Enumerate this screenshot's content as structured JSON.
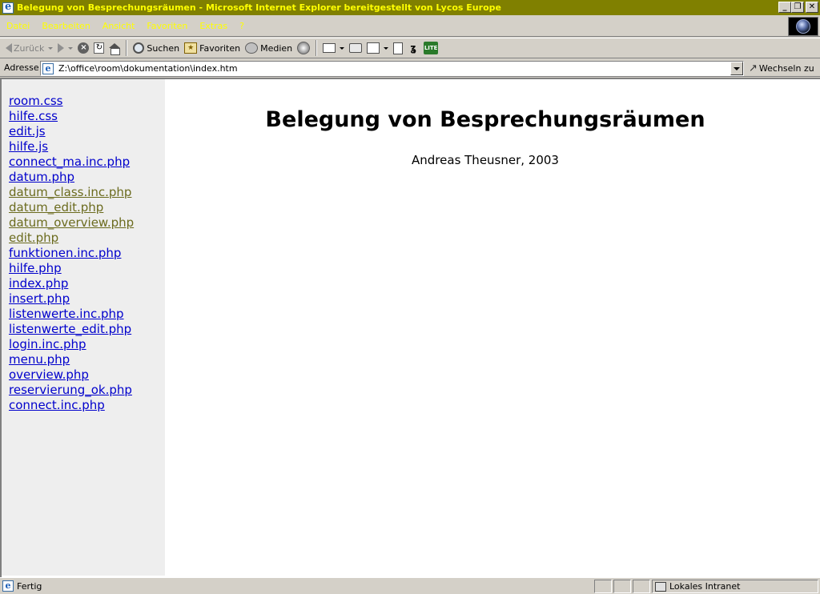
{
  "window": {
    "title": "Belegung von Besprechungsräumen - Microsoft Internet Explorer bereitgestellt von Lycos Europe",
    "minimize": "_",
    "maximize": "❐",
    "close": "✕"
  },
  "menu": {
    "items": [
      "Datei",
      "Bearbeiten",
      "Ansicht",
      "Favoriten",
      "Extras",
      "?"
    ]
  },
  "toolbar": {
    "back_label": "Zurück",
    "search_label": "Suchen",
    "favorites_label": "Favoriten",
    "media_label": "Medien"
  },
  "address": {
    "label": "Adresse",
    "url": "Z:\\office\\room\\dokumentation\\index.htm",
    "go_label": "Wechseln zu"
  },
  "sidebar": {
    "files": [
      {
        "label": "room.css",
        "visited": false
      },
      {
        "label": "hilfe.css",
        "visited": false
      },
      {
        "label": "edit.js",
        "visited": false
      },
      {
        "label": "hilfe.js",
        "visited": false
      },
      {
        "label": "connect_ma.inc.php",
        "visited": false
      },
      {
        "label": "datum.php",
        "visited": false
      },
      {
        "label": "datum_class.inc.php",
        "visited": true
      },
      {
        "label": "datum_edit.php",
        "visited": true
      },
      {
        "label": "datum_overview.php",
        "visited": true
      },
      {
        "label": "edit.php",
        "visited": true
      },
      {
        "label": "funktionen.inc.php",
        "visited": false
      },
      {
        "label": "hilfe.php",
        "visited": false
      },
      {
        "label": "index.php",
        "visited": false
      },
      {
        "label": "insert.php",
        "visited": false
      },
      {
        "label": "listenwerte.inc.php",
        "visited": false
      },
      {
        "label": "listenwerte_edit.php",
        "visited": false
      },
      {
        "label": "login.inc.php",
        "visited": false
      },
      {
        "label": "menu.php",
        "visited": false
      },
      {
        "label": "overview.php",
        "visited": false
      },
      {
        "label": "reservierung_ok.php",
        "visited": false
      },
      {
        "label": "connect.inc.php",
        "visited": false
      }
    ]
  },
  "main": {
    "title": "Belegung von Besprechungsräumen",
    "author": "Andreas Theusner, 2003"
  },
  "status": {
    "text": "Fertig",
    "zone": "Lokales Intranet"
  },
  "colors": {
    "link": "#0000cc",
    "visited_link": "#6b6b1e",
    "title_bar": "#808000",
    "title_text": "#ffff00",
    "sidebar_bg": "#eeeeee"
  }
}
